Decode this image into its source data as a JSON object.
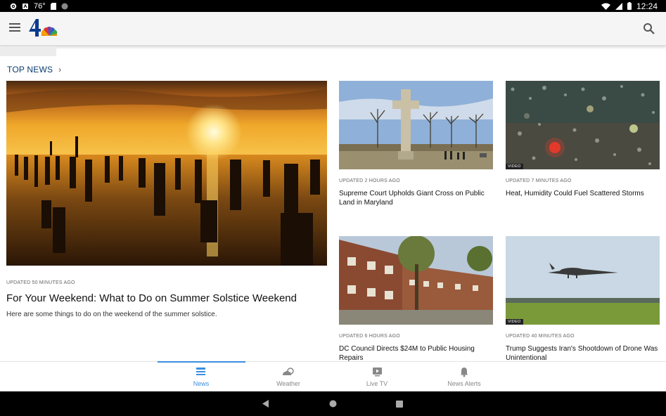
{
  "status_bar": {
    "temperature": "76°",
    "time": "12:24",
    "icons": [
      "gear-icon",
      "notification-icon",
      "sd-card-icon",
      "circle-icon",
      "wifi-icon",
      "signal-icon",
      "battery-icon"
    ]
  },
  "app_bar": {
    "logo": "nbc-4-logo",
    "icons": [
      "menu-icon",
      "search-icon"
    ]
  },
  "section": {
    "title": "TOP NEWS",
    "chevron": "›"
  },
  "hero": {
    "timestamp": "UPDATED 50 MINUTES AGO",
    "title": "For Your Weekend: What to Do on Summer Solstice Weekend",
    "subtitle": "Here are some things to do on the weekend of the summer solstice."
  },
  "cards": [
    {
      "timestamp": "UPDATED 2 HOURS AGO",
      "title": "Supreme Court Upholds Giant Cross on Public Land in Maryland",
      "video": false
    },
    {
      "timestamp": "UPDATED 7 MINUTES AGO",
      "title": "Heat, Humidity Could Fuel Scattered Storms",
      "video": true,
      "badge": "VIDEO"
    },
    {
      "timestamp": "UPDATED 6 HOURS AGO",
      "title": "DC Council Directs $24M to Public Housing Repairs",
      "video": false
    },
    {
      "timestamp": "UPDATED 40 MINUTES AGO",
      "title": "Trump Suggests Iran's Shootdown of Drone Was Unintentional",
      "video": true,
      "badge": "VIDEO"
    }
  ],
  "bottom_nav": {
    "items": [
      {
        "label": "News",
        "icon": "news-icon",
        "active": true
      },
      {
        "label": "Weather",
        "icon": "weather-icon",
        "active": false
      },
      {
        "label": "Live TV",
        "icon": "live-tv-icon",
        "active": false
      },
      {
        "label": "News Alerts",
        "icon": "bell-icon",
        "active": false
      }
    ]
  },
  "colors": {
    "accent": "#3b8fe0",
    "section_title": "#0a3b6e"
  }
}
